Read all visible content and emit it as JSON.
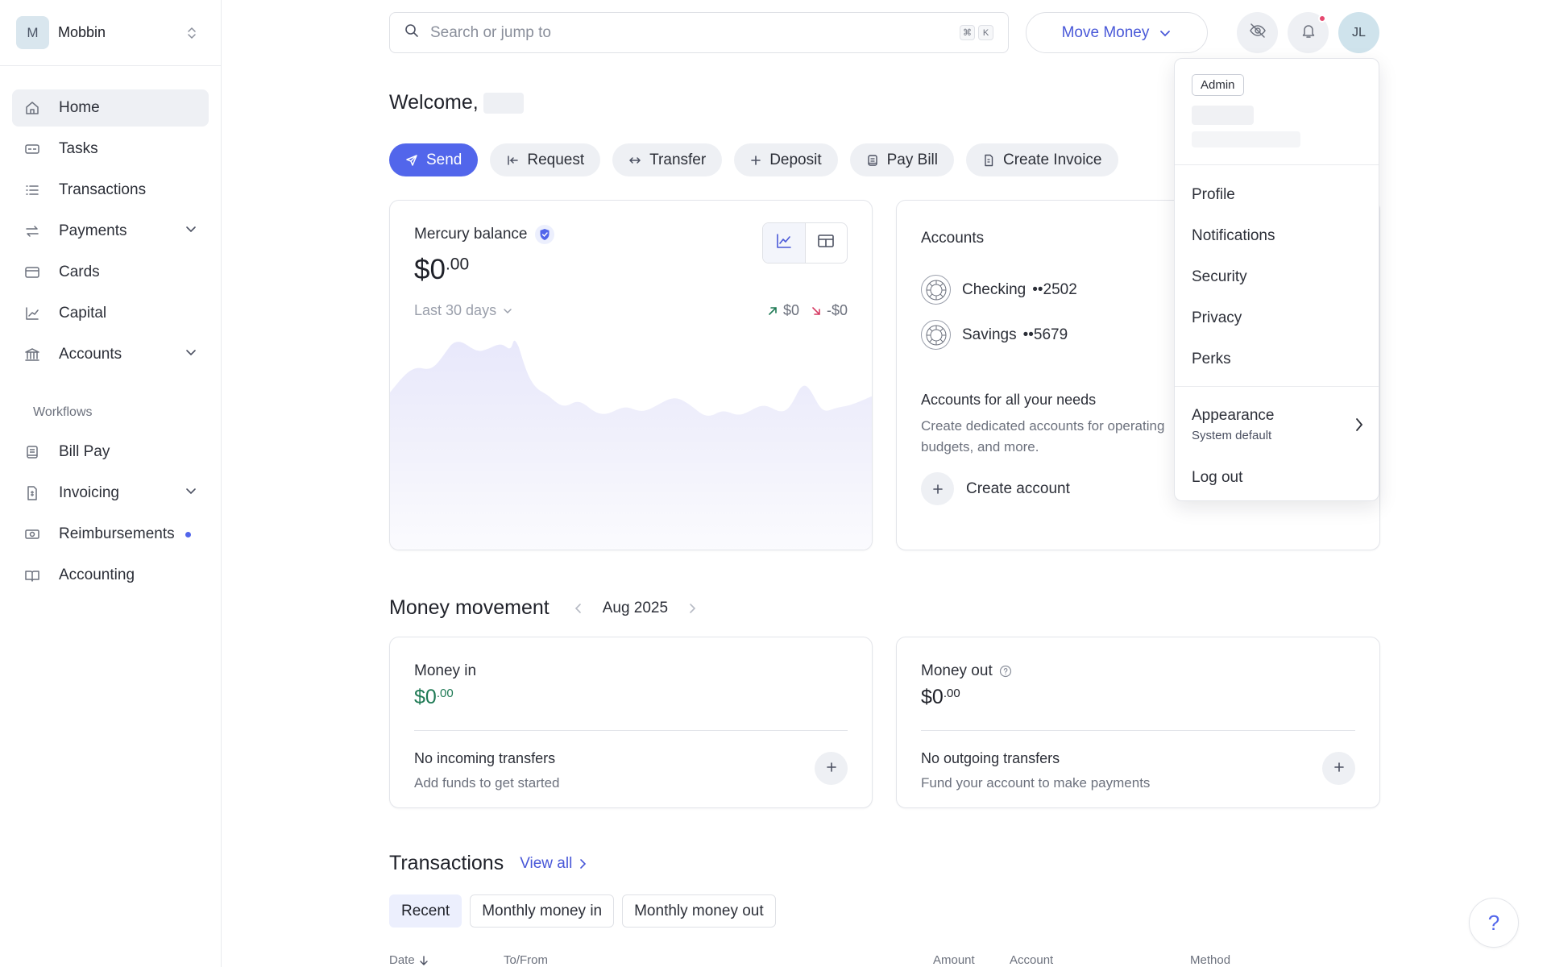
{
  "org": {
    "initial": "M",
    "name": "Mobbin"
  },
  "nav": {
    "items": [
      {
        "label": "Home",
        "icon": "home-icon"
      },
      {
        "label": "Tasks",
        "icon": "tasks-icon"
      },
      {
        "label": "Transactions",
        "icon": "list-icon"
      },
      {
        "label": "Payments",
        "icon": "swap-icon"
      },
      {
        "label": "Cards",
        "icon": "card-icon"
      },
      {
        "label": "Capital",
        "icon": "chart-line-icon"
      },
      {
        "label": "Accounts",
        "icon": "bank-icon"
      }
    ],
    "workflows_label": "Workflows",
    "workflow_items": [
      {
        "label": "Bill Pay",
        "icon": "bill-icon"
      },
      {
        "label": "Invoicing",
        "icon": "invoice-icon"
      },
      {
        "label": "Reimbursements",
        "icon": "cash-icon"
      },
      {
        "label": "Accounting",
        "icon": "book-icon"
      }
    ]
  },
  "topbar": {
    "search_placeholder": "Search or jump to",
    "shortcut_keys": [
      "⌘",
      "K"
    ],
    "move_money_label": "Move Money",
    "avatar_initials": "JL"
  },
  "welcome": {
    "text": "Welcome,"
  },
  "actions": [
    "Send",
    "Request",
    "Transfer",
    "Deposit",
    "Pay Bill",
    "Create Invoice"
  ],
  "balance": {
    "title": "Mercury balance",
    "amount_whole": "$0",
    "amount_cents": ".00",
    "range": "Last 30 days",
    "in": "$0",
    "out": "-$0"
  },
  "accounts": {
    "title": "Accounts",
    "list": [
      {
        "name": "Checking",
        "mask": "••2502"
      },
      {
        "name": "Savings",
        "mask": "••5679"
      }
    ],
    "needs_title": "Accounts for all your needs",
    "needs_desc": "Create dedicated accounts for operating budgets, and more.",
    "create_label": "Create account"
  },
  "money_movement": {
    "title": "Money movement",
    "period": "Aug 2025",
    "in": {
      "label": "Money in",
      "amount_whole": "$0",
      "amount_cents": ".00",
      "empty_title": "No incoming transfers",
      "empty_desc": "Add funds to get started"
    },
    "out": {
      "label": "Money out",
      "amount_whole": "$0",
      "amount_cents": ".00",
      "empty_title": "No outgoing transfers",
      "empty_desc": "Fund your account to make payments"
    }
  },
  "transactions": {
    "title": "Transactions",
    "view_all": "View all",
    "tabs": [
      "Recent",
      "Monthly money in",
      "Monthly money out"
    ],
    "columns": [
      "Date",
      "To/From",
      "Amount",
      "Account",
      "Method"
    ]
  },
  "help": {
    "label": "?"
  },
  "menu": {
    "role": "Admin",
    "items": [
      "Profile",
      "Notifications",
      "Security",
      "Privacy",
      "Perks"
    ],
    "appearance_label": "Appearance",
    "appearance_value": "System default",
    "logout_label": "Log out"
  },
  "colors": {
    "accent": "#5266eb",
    "money_in": "#1f7a55",
    "notification": "#e6486f"
  }
}
